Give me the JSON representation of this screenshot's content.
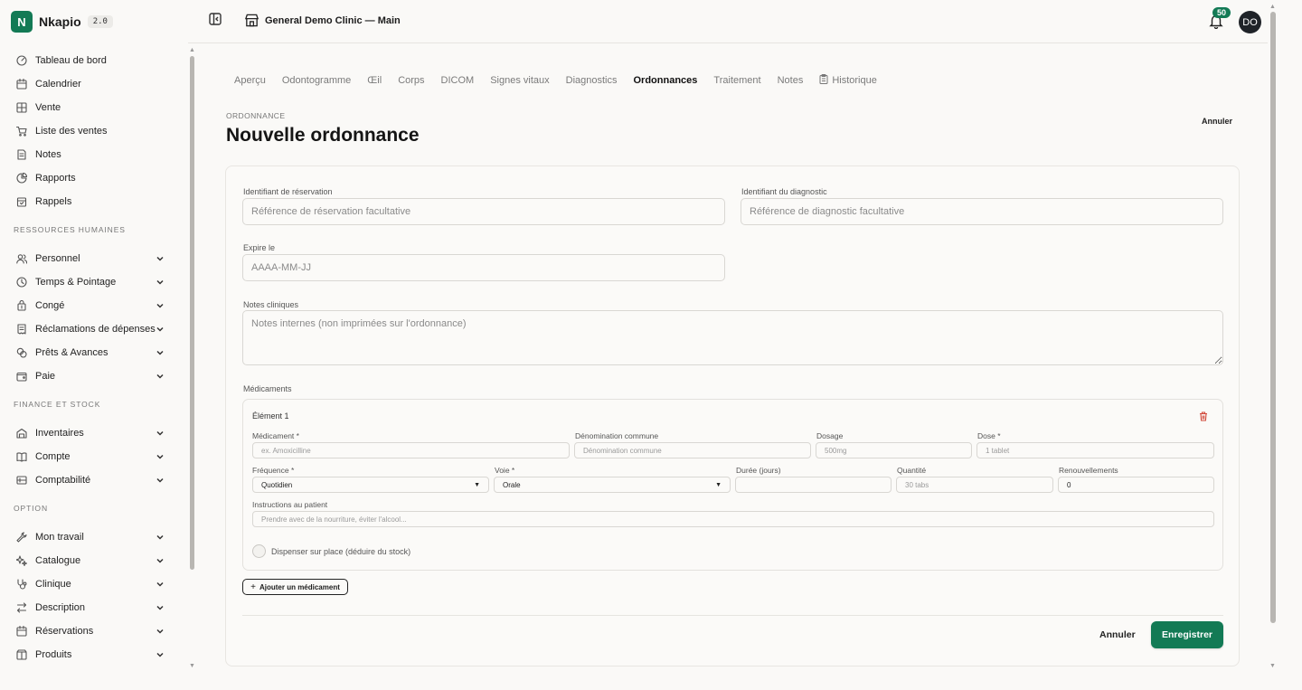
{
  "brand": {
    "logo_letter": "N",
    "name": "Nkapio",
    "version": "2.0",
    "accent": "#137a55"
  },
  "sidebar": {
    "top_items": [
      {
        "label": "Tableau de bord",
        "icon": "dashboard-icon"
      },
      {
        "label": "Calendrier",
        "icon": "calendar-icon"
      },
      {
        "label": "Vente",
        "icon": "grid-icon"
      },
      {
        "label": "Liste des ventes",
        "icon": "cart-icon"
      },
      {
        "label": "Notes",
        "icon": "note-icon"
      },
      {
        "label": "Rapports",
        "icon": "pie-chart-icon"
      },
      {
        "label": "Rappels",
        "icon": "alarm-icon"
      }
    ],
    "hr_section": "RESSOURCES HUMAINES",
    "hr_items": [
      {
        "label": "Personnel",
        "icon": "users-icon"
      },
      {
        "label": "Temps & Pointage",
        "icon": "clock-icon"
      },
      {
        "label": "Congé",
        "icon": "sun-icon"
      },
      {
        "label": "Réclamations de dépenses",
        "icon": "receipt-icon"
      },
      {
        "label": "Prêts & Avances",
        "icon": "coins-icon"
      },
      {
        "label": "Paie",
        "icon": "wallet-icon"
      }
    ],
    "finance_section": "FINANCE ET STOCK",
    "finance_items": [
      {
        "label": "Inventaires",
        "icon": "warehouse-icon"
      },
      {
        "label": "Compte",
        "icon": "book-icon"
      },
      {
        "label": "Comptabilité",
        "icon": "ledger-icon"
      }
    ],
    "option_section": "OPTION",
    "option_items": [
      {
        "label": "Mon travail",
        "icon": "wrench-icon"
      },
      {
        "label": "Catalogue",
        "icon": "sparkle-icon"
      },
      {
        "label": "Clinique",
        "icon": "stethoscope-icon"
      },
      {
        "label": "Description",
        "icon": "swap-icon"
      },
      {
        "label": "Réservations",
        "icon": "calendar-check-icon"
      },
      {
        "label": "Produits",
        "icon": "box-icon"
      }
    ]
  },
  "header": {
    "clinic": "General Demo Clinic — Main",
    "notifications": "50",
    "avatar": "DO"
  },
  "tabs": [
    "Aperçu",
    "Odontogramme",
    "Œil",
    "Corps",
    "DICOM",
    "Signes vitaux",
    "Diagnostics",
    "Ordonnances",
    "Traitement",
    "Notes",
    "Historique"
  ],
  "active_tab": "Ordonnances",
  "page": {
    "kicker": "ORDONNANCE",
    "title": "Nouvelle ordonnance",
    "cancel": "Annuler"
  },
  "form": {
    "reservation_label": "Identifiant de réservation",
    "reservation_placeholder": "Référence de réservation facultative",
    "diagnosis_label": "Identifiant du diagnostic",
    "diagnosis_placeholder": "Référence de diagnostic facultative",
    "expires_label": "Expire le",
    "expires_placeholder": "AAAA-MM-JJ",
    "notes_label": "Notes cliniques",
    "notes_placeholder": "Notes internes (non imprimées sur l'ordonnance)",
    "meds_label": "Médicaments",
    "item": {
      "title": "Élément 1",
      "med_label": "Médicament *",
      "med_placeholder": "ex. Amoxicilline",
      "generic_label": "Dénomination commune",
      "generic_placeholder": "Dénomination commune",
      "dosage_label": "Dosage",
      "dosage_placeholder": "500mg",
      "dose_label": "Dose *",
      "dose_placeholder": "1 tablet",
      "frequency_label": "Fréquence *",
      "frequency_value": "Quotidien",
      "route_label": "Voie *",
      "route_value": "Orale",
      "duration_label": "Durée (jours)",
      "duration_value": "",
      "quantity_label": "Quantité",
      "quantity_placeholder": "30 tabs",
      "refills_label": "Renouvellements",
      "refills_value": "0",
      "instructions_label": "Instructions au patient",
      "instructions_placeholder": "Prendre avec de la nourriture, éviter l'alcool...",
      "dispense_label": "Dispenser sur place (déduire du stock)"
    },
    "add_med": "Ajouter un médicament",
    "cancel": "Annuler",
    "save": "Enregistrer"
  }
}
